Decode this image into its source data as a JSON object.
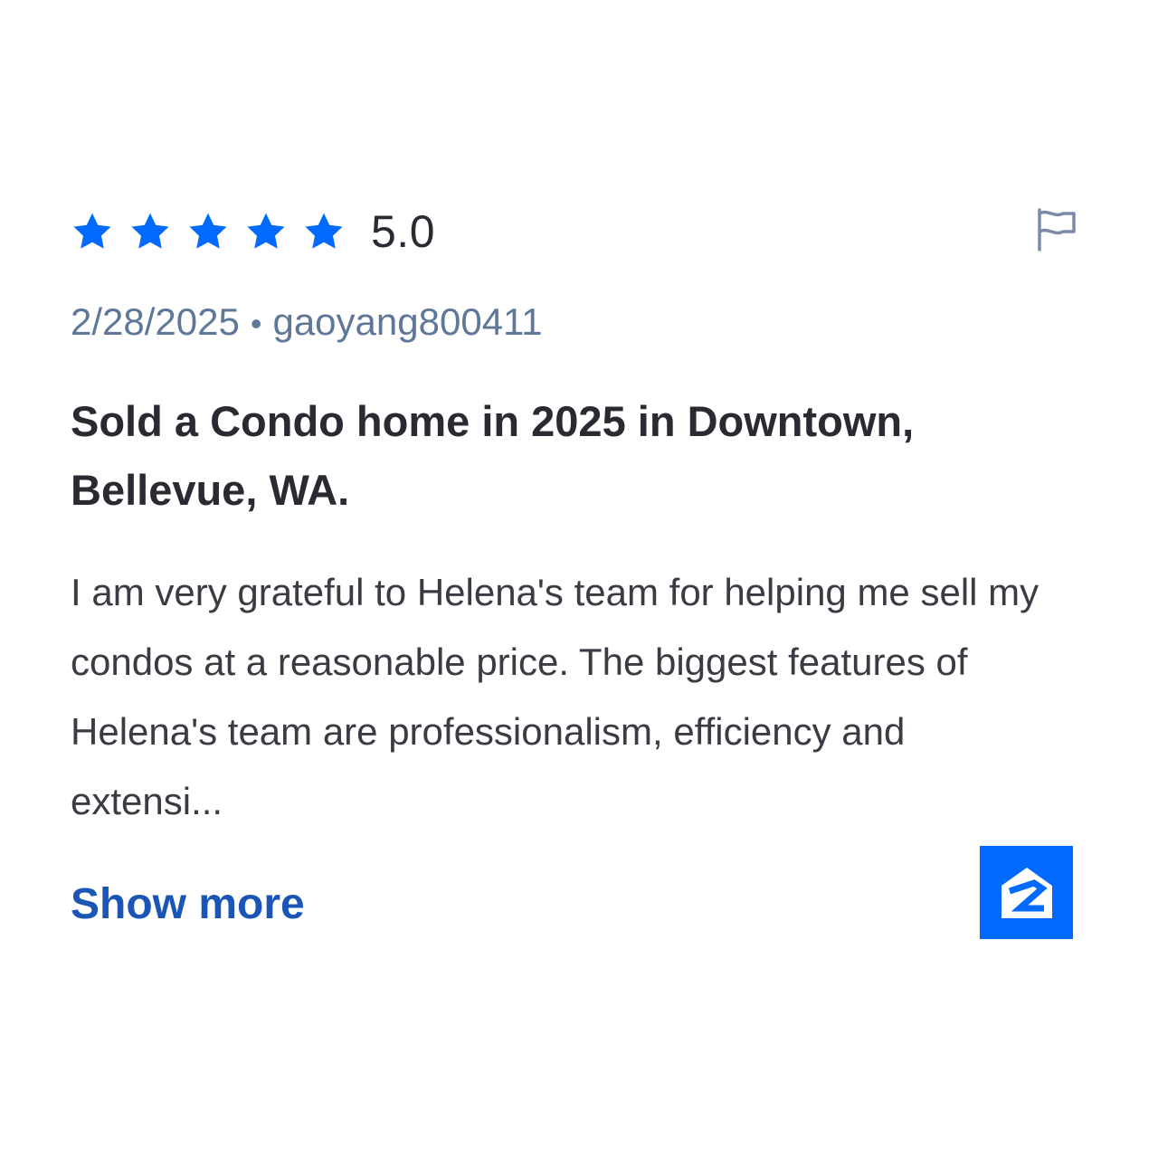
{
  "review": {
    "rating": 5,
    "rating_max": 5,
    "rating_text": "5.0",
    "date": "2/28/2025",
    "separator": "•",
    "author": "gaoyang800411",
    "title": "Sold a Condo home in 2025 in Downtown, Bellevue, WA.",
    "body": "I am very grateful to Helena's team for helping me sell my condos at a reasonable price. The biggest features of Helena's team are professionalism, efficiency and extensi...",
    "show_more_label": "Show more"
  },
  "icons": {
    "star": "star-icon",
    "report": "flag-icon",
    "source": "zillow-logo-icon"
  },
  "colors": {
    "star": "#006aff",
    "meta_text": "#5f7799",
    "title_text": "#2a2a33",
    "link": "#1b55b5",
    "logo_bg": "#006aff"
  }
}
